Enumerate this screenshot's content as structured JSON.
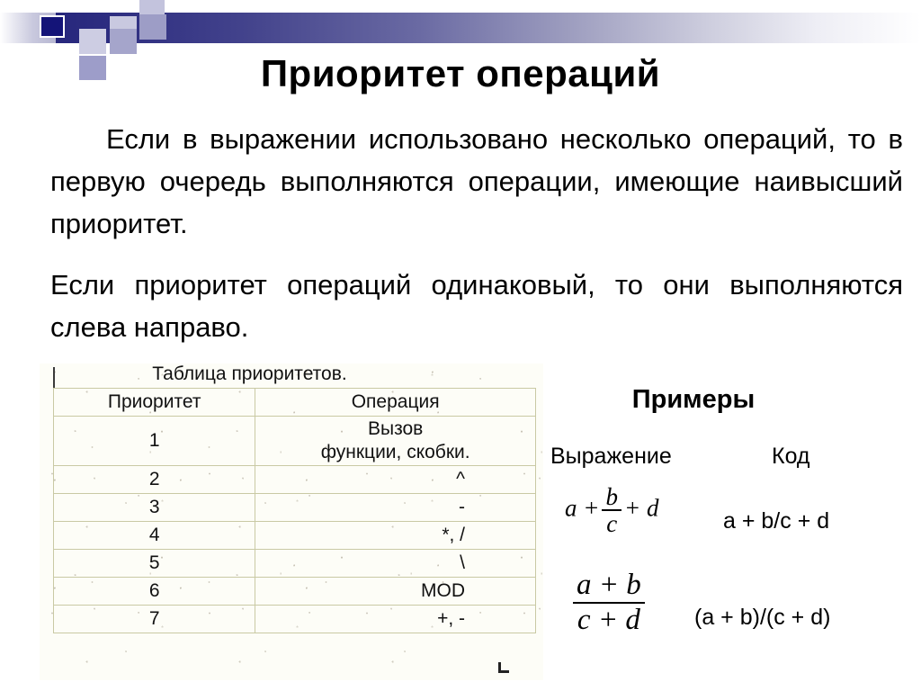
{
  "slide": {
    "title": "Приоритет операций"
  },
  "body": {
    "paragraph_1": "Если в выражении использовано несколько операций, то в первую очередь выполняются операции, имеющие наивысший приоритет.",
    "paragraph_1_lines": [
      "Если в выражении использовано несколько",
      "операций, то в первую очередь выполняются",
      "операции, имеющие наивысший приоритет."
    ],
    "paragraph_2": "Если приоритет операций одинаковый, то они выполняются слева направо.",
    "paragraph_2_lines": [
      "Если приоритет операций одинаковый, то они",
      "выполняются слева направо."
    ]
  },
  "table": {
    "caption": "Таблица приоритетов.",
    "headers": [
      "Приоритет",
      "Операция"
    ],
    "rows": [
      {
        "priority": "1",
        "operation": "Вызов функции, скобки.",
        "operation_line_1": "Вызов",
        "operation_line_2": "функции, скобки."
      },
      {
        "priority": "2",
        "operation": "^"
      },
      {
        "priority": "3",
        "operation": "-"
      },
      {
        "priority": "4",
        "operation": "*, /"
      },
      {
        "priority": "5",
        "operation": "\\"
      },
      {
        "priority": "6",
        "operation": "MOD"
      },
      {
        "priority": "7",
        "operation": "+, -"
      }
    ],
    "grid_color": "#c9c9a4",
    "paper_color": "#fdfdf7"
  },
  "examples": {
    "title": "Примеры",
    "column_headers": {
      "expression": "Выражение",
      "code": "Код"
    },
    "items": [
      {
        "expression_plain": "a + b/c + d",
        "expr_lead": "a +",
        "expr_frac_num": "b",
        "expr_frac_den": "c",
        "expr_tail": "+ d",
        "code": "a + b/c + d"
      },
      {
        "expression_plain": "(a + b)/(c + d)",
        "expr_frac_num": "a + b",
        "expr_frac_den": "c + d",
        "code": "(a + b)/(c + d)"
      }
    ]
  },
  "decor": {
    "gradient_start": "#27277d",
    "gradient_end": "#ffffff",
    "accent_square": "#141478"
  }
}
